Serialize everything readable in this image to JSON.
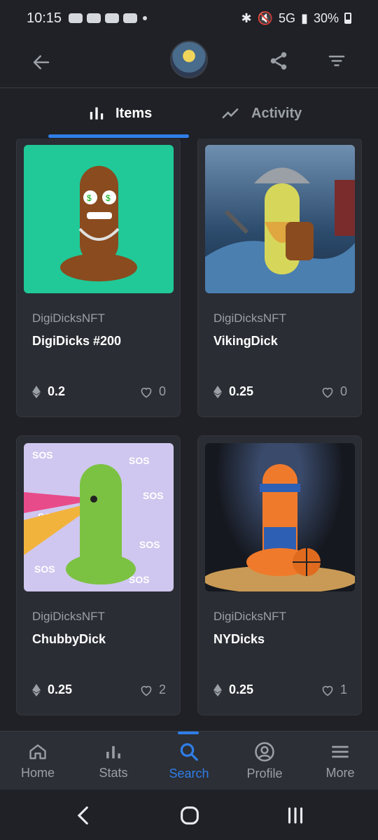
{
  "status_bar": {
    "time": "10:15",
    "network": "5G",
    "battery": "30%"
  },
  "tabs": [
    {
      "label": "Items",
      "active": true
    },
    {
      "label": "Activity",
      "active": false
    }
  ],
  "items": [
    {
      "collection": "DigiDicksNFT",
      "name": "DigiDicks #200",
      "price": "0.2",
      "likes": "0",
      "bg": "#20c997"
    },
    {
      "collection": "DigiDicksNFT",
      "name": "VikingDick",
      "price": "0.25",
      "likes": "0",
      "bg": "#2b4a6b"
    },
    {
      "collection": "DigiDicksNFT",
      "name": "ChubbyDick",
      "price": "0.25",
      "likes": "2",
      "bg": "#cfc7ef"
    },
    {
      "collection": "DigiDicksNFT",
      "name": "NYDicks",
      "price": "0.25",
      "likes": "1",
      "bg": "#15181f"
    }
  ],
  "bottom_nav": [
    {
      "label": "Home",
      "icon": "home-icon"
    },
    {
      "label": "Stats",
      "icon": "stats-icon"
    },
    {
      "label": "Search",
      "icon": "search-icon",
      "active": true
    },
    {
      "label": "Profile",
      "icon": "profile-icon"
    },
    {
      "label": "More",
      "icon": "menu-icon"
    }
  ],
  "colors": {
    "accent": "#2f7ee8",
    "background": "#1f2126",
    "card": "#2a2d33"
  }
}
